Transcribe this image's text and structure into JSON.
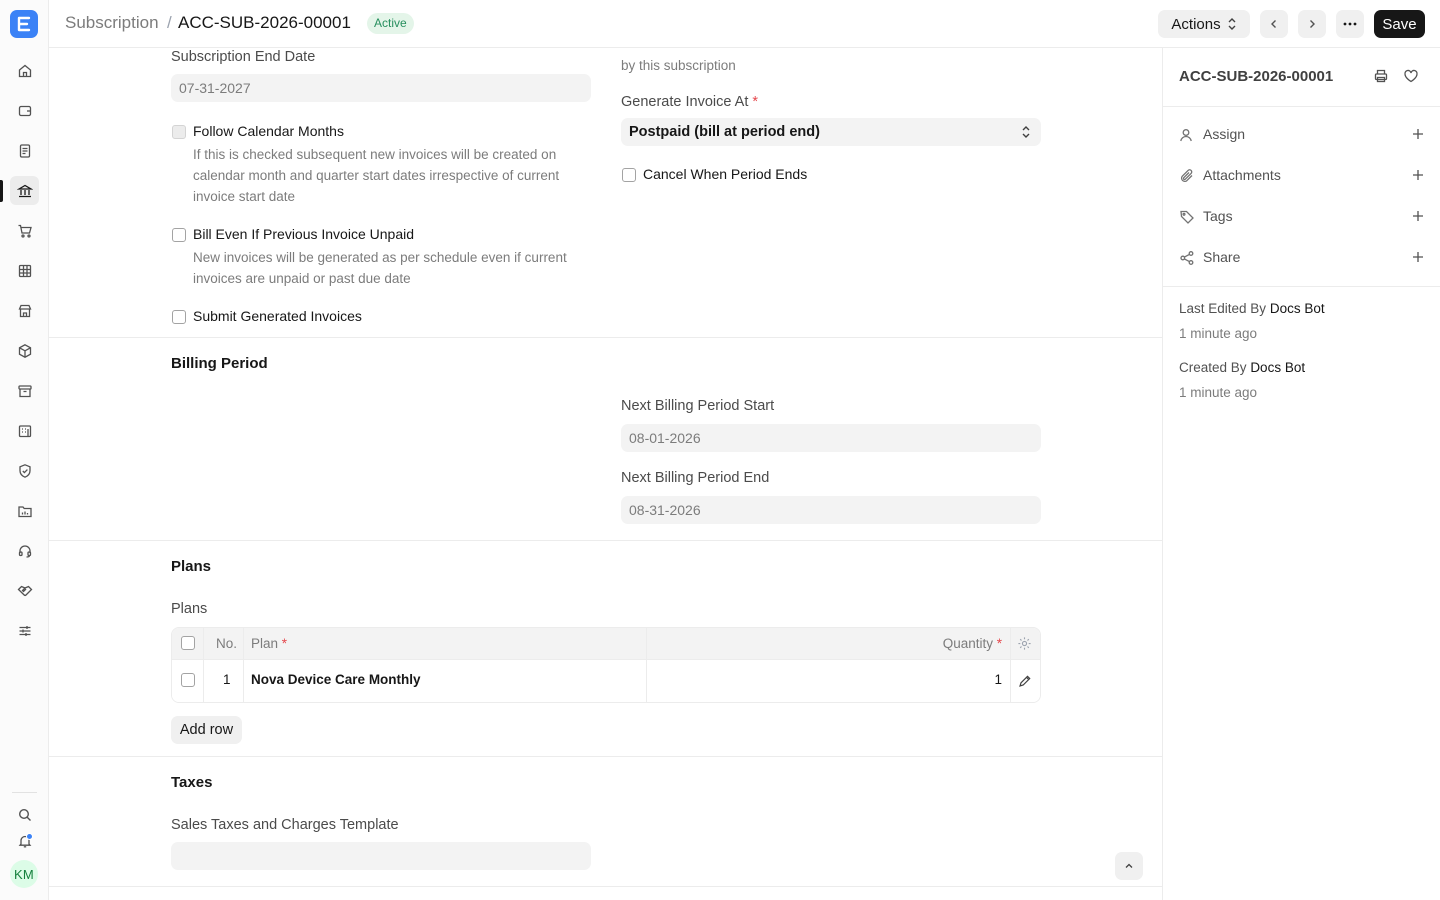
{
  "app": {
    "logo_letter": "E",
    "user_initials": "KM"
  },
  "header": {
    "breadcrumb_parent": "Subscription",
    "separator": "/",
    "doc_name": "ACC-SUB-2026-00001",
    "status": "Active",
    "actions_label": "Actions",
    "save_label": "Save"
  },
  "form": {
    "top_right_cut_text": "by this subscription",
    "subscription_end_date_label": "Subscription End Date",
    "subscription_end_date_value": "07-31-2027",
    "generate_invoice_at_label": "Generate Invoice At",
    "generate_invoice_at_value": "Postpaid (bill at period end)",
    "follow_calendar_months_label": "Follow Calendar Months",
    "follow_calendar_months_help_1": "If this is checked subsequent new invoices will be created on",
    "follow_calendar_months_help_2": "calendar month and quarter start dates irrespective of current",
    "follow_calendar_months_help_3": "invoice start date",
    "cancel_when_period_ends_label": "Cancel When Period Ends",
    "bill_even_if_unpaid_label": "Bill Even If Previous Invoice Unpaid",
    "bill_even_if_unpaid_help_1": "New invoices will be generated as per schedule even if current",
    "bill_even_if_unpaid_help_2": "invoices are unpaid or past due date",
    "submit_generated_invoices_label": "Submit Generated Invoices",
    "billing_period_title": "Billing Period",
    "next_billing_start_label": "Next Billing Period Start",
    "next_billing_start_value": "08-01-2026",
    "next_billing_end_label": "Next Billing Period End",
    "next_billing_end_value": "08-31-2026",
    "plans_section_title": "Plans",
    "plans_table_label": "Plans",
    "plans_table": {
      "col_no": "No.",
      "col_plan": "Plan",
      "col_quantity": "Quantity",
      "rows": [
        {
          "no": "1",
          "plan": "Nova Device Care Monthly",
          "quantity": "1"
        }
      ]
    },
    "add_row_label": "Add row",
    "taxes_title": "Taxes",
    "sales_taxes_template_label": "Sales Taxes and Charges Template",
    "sales_taxes_template_value": ""
  },
  "sidebar": {
    "doc_name": "ACC-SUB-2026-00001",
    "items": [
      {
        "label": "Assign",
        "icon": "user-icon"
      },
      {
        "label": "Attachments",
        "icon": "paperclip-icon"
      },
      {
        "label": "Tags",
        "icon": "tag-icon"
      },
      {
        "label": "Share",
        "icon": "share-icon"
      }
    ],
    "last_edited_prefix": "Last Edited By",
    "last_edited_by": "Docs Bot",
    "last_edited_time": "1 minute ago",
    "created_prefix": "Created By",
    "created_by": "Docs Bot",
    "created_time": "1 minute ago"
  },
  "colors": {
    "accent": "#3b82f6",
    "status_active_bg": "#e4f5e9",
    "status_active_text": "#278f5e",
    "save_bg": "#171717"
  }
}
